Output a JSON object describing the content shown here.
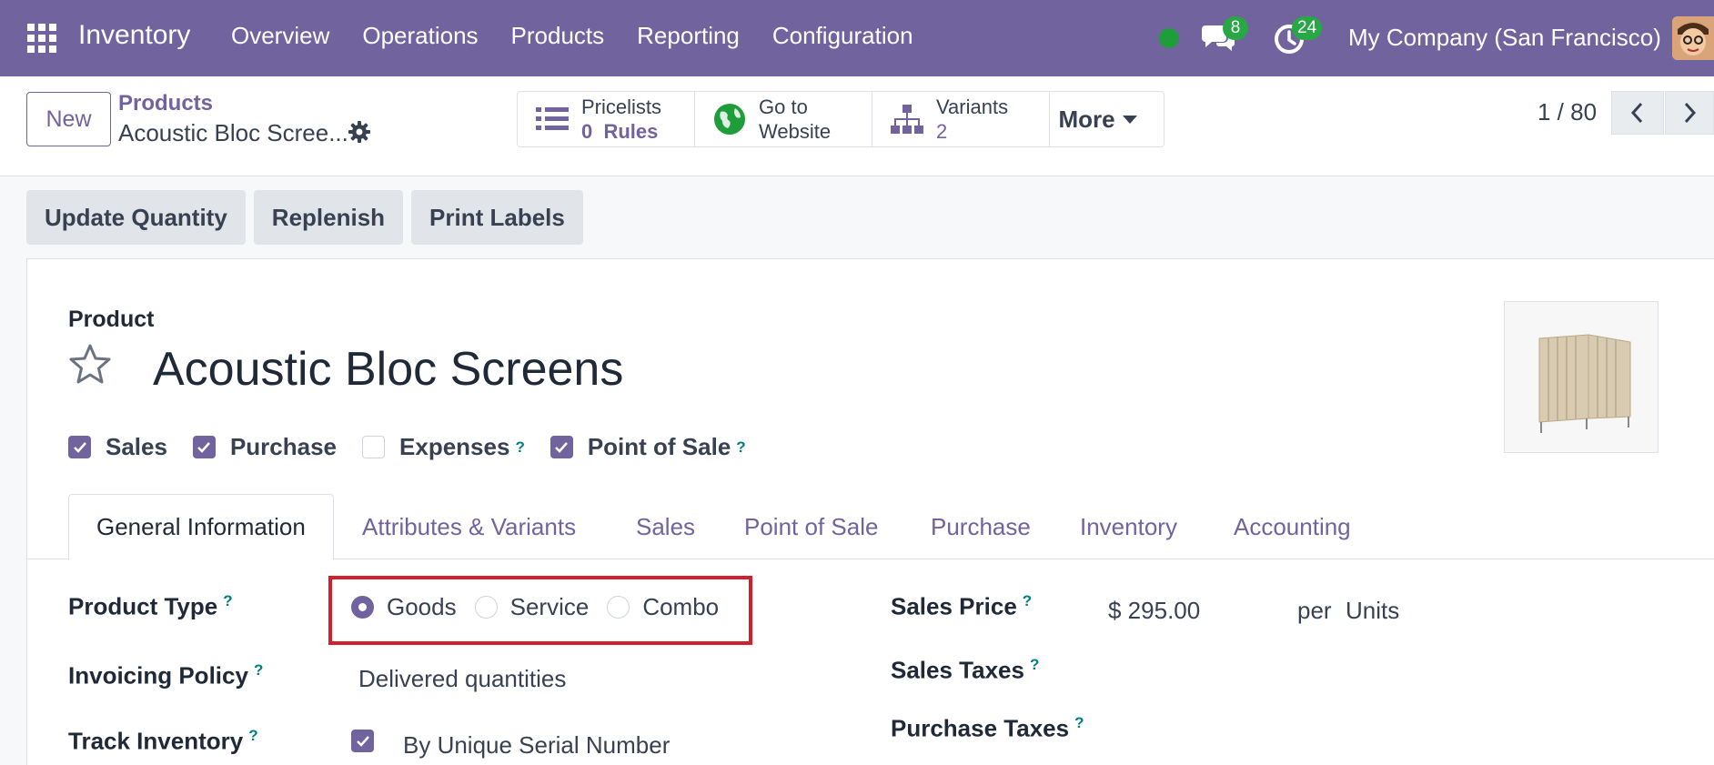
{
  "navbar": {
    "app_name": "Inventory",
    "menu": [
      "Overview",
      "Operations",
      "Products",
      "Reporting",
      "Configuration"
    ],
    "messages_count": "8",
    "activities_count": "24",
    "company": "My Company (San Francisco)"
  },
  "control": {
    "new_label": "New",
    "breadcrumb_parent": "Products",
    "breadcrumb_current": "Acoustic Bloc Scree...",
    "stats": {
      "pricelists_label": "Pricelists",
      "pricelists_value": "0",
      "pricelists_unit": "Rules",
      "website_line1": "Go to",
      "website_line2": "Website",
      "variants_label": "Variants",
      "variants_value": "2",
      "more_label": "More"
    },
    "pager": "1 / 80"
  },
  "actions": [
    "Update Quantity",
    "Replenish",
    "Print Labels"
  ],
  "form": {
    "product_label": "Product",
    "product_name": "Acoustic Bloc Screens",
    "checkboxes": [
      {
        "label": "Sales",
        "checked": true
      },
      {
        "label": "Purchase",
        "checked": true
      },
      {
        "label": "Expenses",
        "checked": false,
        "help": "?"
      },
      {
        "label": "Point of Sale",
        "checked": true,
        "help": "?"
      }
    ],
    "tabs": [
      "General Information",
      "Attributes & Variants",
      "Sales",
      "Point of Sale",
      "Purchase",
      "Inventory",
      "Accounting"
    ],
    "product_type_label": "Product Type",
    "product_type_options": [
      "Goods",
      "Service",
      "Combo"
    ],
    "product_type_selected": "Goods",
    "invoicing_policy_label": "Invoicing Policy",
    "invoicing_policy_value": "Delivered quantities",
    "track_inventory_label": "Track Inventory",
    "track_inventory_value": "By Unique Serial Number",
    "sales_price_label": "Sales Price",
    "sales_price_value": "$ 295.00",
    "sales_price_per": "per",
    "sales_price_unit": "Units",
    "sales_taxes_label": "Sales Taxes",
    "purchase_taxes_label": "Purchase Taxes",
    "help_mark": "?"
  },
  "colors": {
    "brand": "#71639e",
    "highlight": "#d0202e",
    "badge": "#28a745"
  }
}
